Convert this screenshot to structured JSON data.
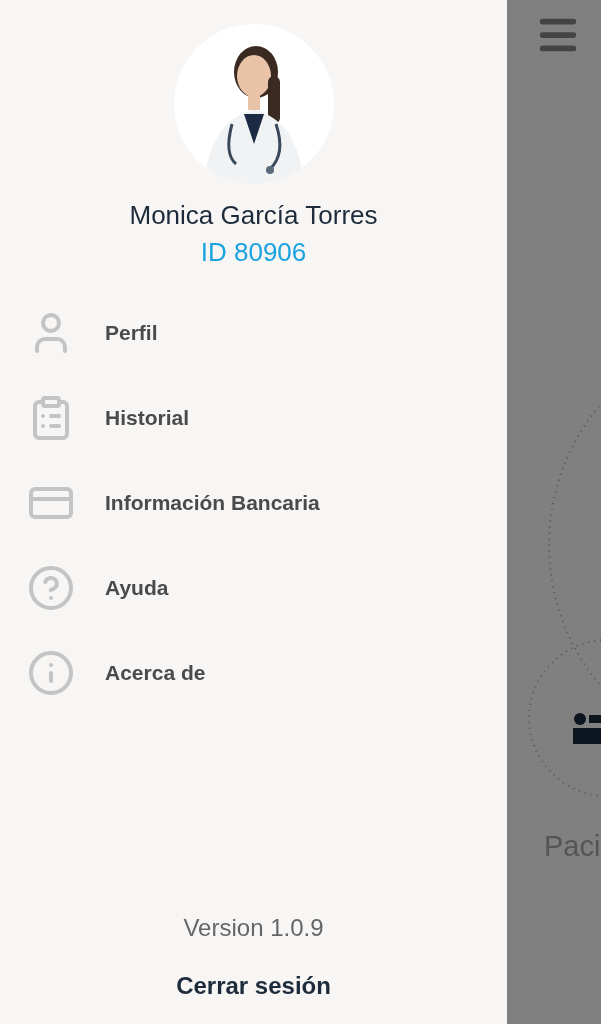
{
  "profile": {
    "name": "Monica García Torres",
    "id": "ID 80906"
  },
  "menu": [
    {
      "kind": "user",
      "label": "Perfil"
    },
    {
      "kind": "clipboard",
      "label": "Historial"
    },
    {
      "kind": "card",
      "label": "Información Bancaria"
    },
    {
      "kind": "help",
      "label": "Ayuda"
    },
    {
      "kind": "info",
      "label": "Acerca de"
    }
  ],
  "version": "Version 1.0.9",
  "logout": "Cerrar sesión",
  "background": {
    "tile_label": "Paci"
  }
}
